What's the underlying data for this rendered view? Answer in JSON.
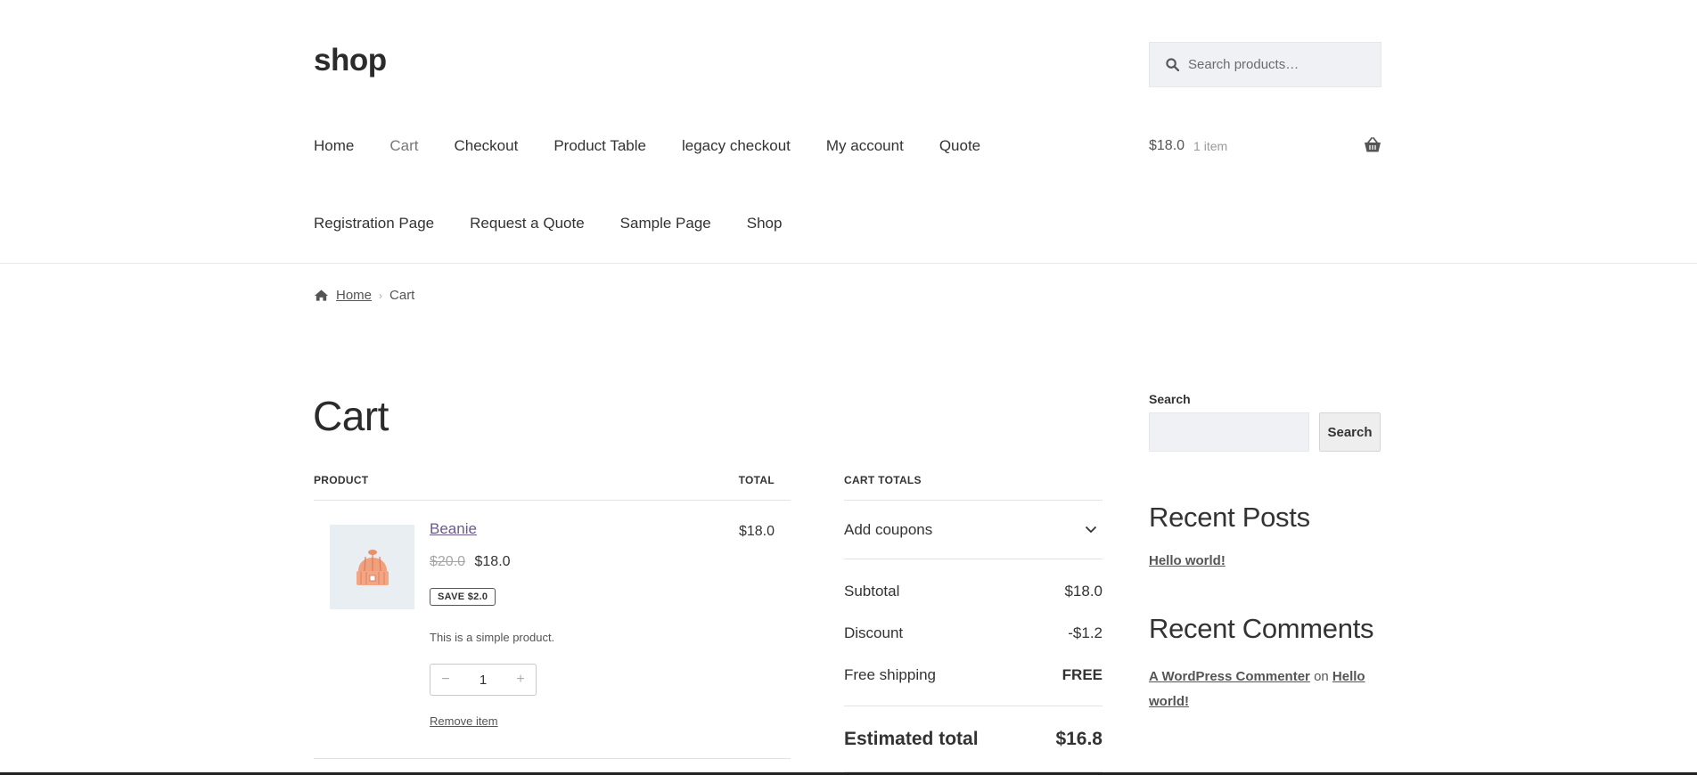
{
  "site": {
    "title": "shop"
  },
  "search": {
    "placeholder": "Search products…"
  },
  "nav": {
    "row1": [
      "Home",
      "Cart",
      "Checkout",
      "Product Table",
      "legacy checkout",
      "My account",
      "Quote"
    ],
    "row2": [
      "Registration Page",
      "Request a Quote",
      "Sample Page",
      "Shop"
    ],
    "current": "Cart"
  },
  "mini_cart": {
    "amount": "$18.0",
    "count": "1 item"
  },
  "breadcrumb": {
    "home": "Home",
    "current": "Cart"
  },
  "page": {
    "title": "Cart"
  },
  "cart": {
    "col_product": "PRODUCT",
    "col_total": "TOTAL",
    "item": {
      "name": "Beanie",
      "old_price": "$20.0",
      "price": "$18.0",
      "save": "SAVE $2.0",
      "description": "This is a simple product.",
      "qty_minus": "−",
      "quantity": "1",
      "qty_plus": "+",
      "remove": "Remove item",
      "total": "$18.0"
    }
  },
  "totals": {
    "heading": "CART TOTALS",
    "coupons": "Add coupons",
    "subtotal_label": "Subtotal",
    "subtotal": "$18.0",
    "discount_label": "Discount",
    "discount": "-$1.2",
    "shipping_label": "Free shipping",
    "shipping": "FREE",
    "estimated_label": "Estimated total",
    "estimated": "$16.8"
  },
  "sidebar": {
    "search_label": "Search",
    "search_button": "Search",
    "recent_posts_title": "Recent Posts",
    "recent_post": "Hello world!",
    "recent_comments_title": "Recent Comments",
    "comment_author": "A WordPress Commenter",
    "comment_on": "on",
    "comment_post": "Hello world!"
  },
  "colors": {
    "link_purple": "#6a5a8a",
    "text": "#333333",
    "muted": "#777777"
  },
  "icons": [
    "search-icon",
    "basket-icon",
    "home-icon",
    "chevron-down-icon",
    "beanie-image"
  ]
}
